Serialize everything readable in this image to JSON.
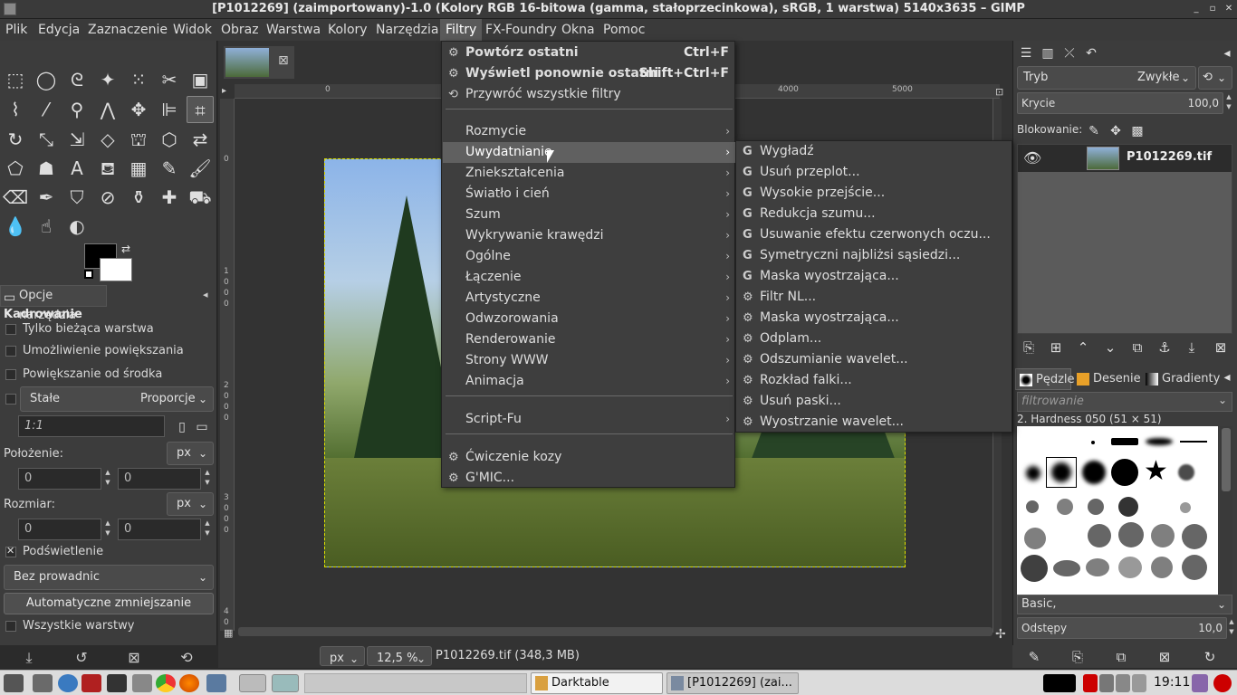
{
  "window": {
    "title": "[P1012269] (zaimportowany)-1.0 (Kolory RGB 16-bitowa (gamma, stałoprzecinkowa), sRGB, 1 warstwa) 5140x3635 – GIMP"
  },
  "menubar": {
    "items": [
      "Plik",
      "Edycja",
      "Zaznaczenie",
      "Widok",
      "Obraz",
      "Warstwa",
      "Kolory",
      "Narzędzia",
      "Filtry",
      "FX-Foundry",
      "Okna",
      "Pomoc"
    ],
    "active": "Filtry"
  },
  "tool_options": {
    "tab_label": "Opcje narzędzia",
    "heading": "Kadrowanie",
    "current_layer_only": "Tylko bieżąca warstwa",
    "allow_growing": "Umożliwienie powiększania",
    "expand_center": "Powiększanie od środka",
    "fixed_label": "Stałe",
    "fixed_mode": "Proporcje",
    "ratio_value": "1:1",
    "position_label": "Położenie:",
    "position_unit": "px",
    "position_x": "0",
    "position_y": "0",
    "size_label": "Rozmiar:",
    "size_unit": "px",
    "size_x": "0",
    "size_y": "0",
    "highlight": "Podświetlenie",
    "guides": "Bez prowadnic",
    "auto_shrink": "Automatyczne zmniejszanie",
    "all_layers": "Wszystkie warstwy"
  },
  "rulers": {
    "h_ticks": [
      "0",
      "4000",
      "5000"
    ],
    "v_ticks": [
      "0",
      "1",
      "0",
      "0",
      "0",
      "2",
      "0",
      "0",
      "0",
      "3",
      "0",
      "0",
      "0",
      "4",
      "0"
    ]
  },
  "statusbar": {
    "unit": "px",
    "zoom": "12,5 %",
    "file": "P1012269.tif (348,3 MB)"
  },
  "layers": {
    "mode_label": "Tryb",
    "mode_value": "Zwykłe",
    "opacity_label": "Krycie",
    "opacity_value": "100,0",
    "lock_label": "Blokowanie:",
    "layer_name": "P1012269.tif"
  },
  "brushes": {
    "tabs": [
      "Pędzle",
      "Desenie",
      "Gradienty"
    ],
    "filter_placeholder": "filtrowanie",
    "selected_brush": "2. Hardness 050 (51 × 51)",
    "set": "Basic,",
    "spacing_label": "Odstępy",
    "spacing_value": "10,0"
  },
  "filters_menu": {
    "items": [
      {
        "label": "Powtórz ostatni",
        "shortcut": "Ctrl+F",
        "bold": true,
        "icon": "gear"
      },
      {
        "label": "Wyświetl ponownie ostatni",
        "shortcut": "Shift+Ctrl+F",
        "bold": true,
        "icon": "gear"
      },
      {
        "label": "Przywróć wszystkie filtry",
        "icon": "reset"
      },
      {
        "label": "Rozmycie",
        "submenu": true
      },
      {
        "label": "Uwydatnianie",
        "submenu": true,
        "highlighted": true
      },
      {
        "label": "Zniekształcenia",
        "submenu": true
      },
      {
        "label": "Światło i cień",
        "submenu": true
      },
      {
        "label": "Szum",
        "submenu": true
      },
      {
        "label": "Wykrywanie krawędzi",
        "submenu": true
      },
      {
        "label": "Ogólne",
        "submenu": true
      },
      {
        "label": "Łączenie",
        "submenu": true
      },
      {
        "label": "Artystyczne",
        "submenu": true
      },
      {
        "label": "Odwzorowania",
        "submenu": true
      },
      {
        "label": "Renderowanie",
        "submenu": true
      },
      {
        "label": "Strony WWW",
        "submenu": true
      },
      {
        "label": "Animacja",
        "submenu": true
      },
      {
        "label": "Script-Fu",
        "submenu": true
      },
      {
        "label": "Ćwiczenie kozy",
        "icon": "gear"
      },
      {
        "label": "G'MIC...",
        "icon": "gear"
      }
    ]
  },
  "enhance_submenu": {
    "items": [
      {
        "label": "Wygładź",
        "icon": "G"
      },
      {
        "label": "Usuń przeplot...",
        "icon": "G"
      },
      {
        "label": "Wysokie przejście...",
        "icon": "G"
      },
      {
        "label": "Redukcja szumu...",
        "icon": "G"
      },
      {
        "label": "Usuwanie efektu czerwonych oczu...",
        "icon": "G"
      },
      {
        "label": "Symetryczni najbliżsi sąsiedzi...",
        "icon": "G"
      },
      {
        "label": "Maska wyostrzająca...",
        "icon": "G"
      },
      {
        "label": "Filtr NL...",
        "icon": "gear"
      },
      {
        "label": "Maska wyostrzająca...",
        "icon": "gear"
      },
      {
        "label": "Odplam...",
        "icon": "gear"
      },
      {
        "label": "Odszumianie wavelet...",
        "icon": "gear"
      },
      {
        "label": "Rozkład falki...",
        "icon": "gear"
      },
      {
        "label": "Usuń paski...",
        "icon": "gear"
      },
      {
        "label": "Wyostrzanie wavelet...",
        "icon": "gear"
      }
    ]
  },
  "taskbar": {
    "tasks": [
      "Darktable",
      "[P1012269] (zai..."
    ],
    "clock": "19:11"
  }
}
